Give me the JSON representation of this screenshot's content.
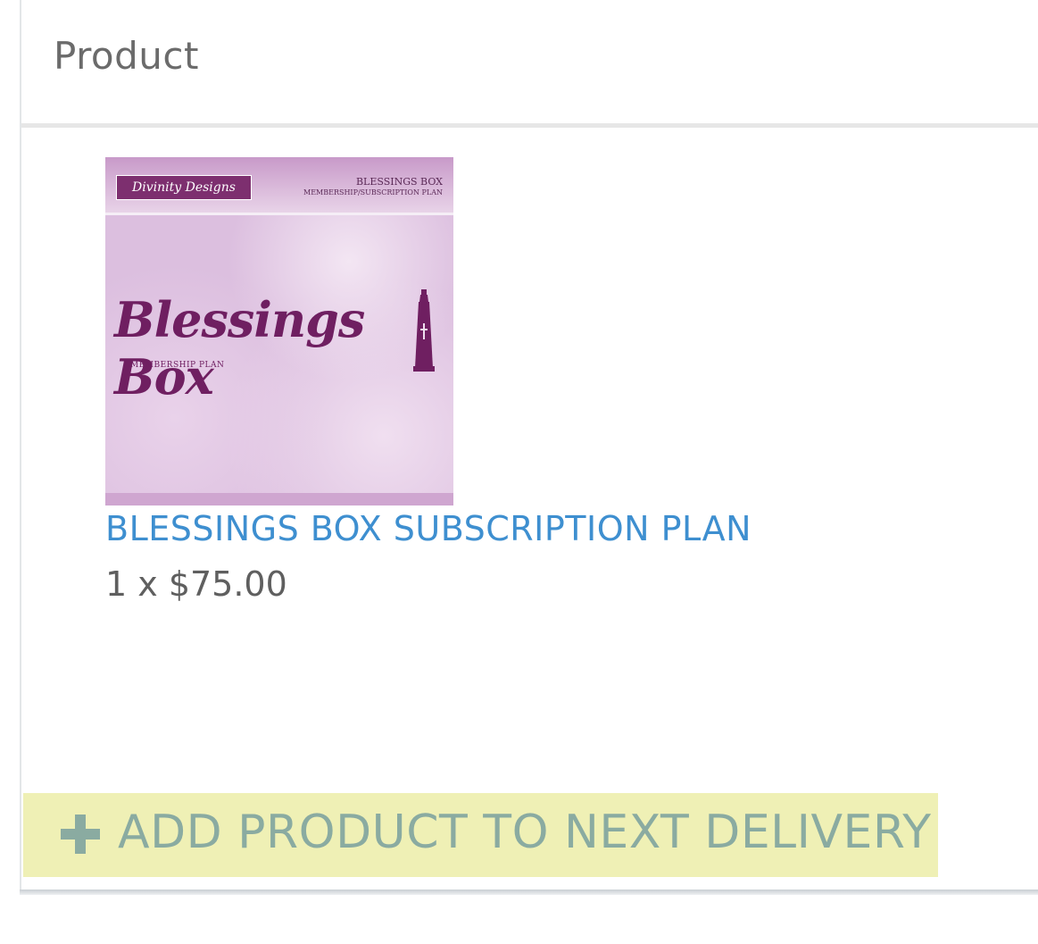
{
  "header": {
    "title": "Product"
  },
  "product": {
    "image": {
      "alt_icon": "product-image",
      "brand": "Divinity Designs",
      "caption_title": "BLESSINGS BOX",
      "caption_sub": "MEMBERSHIP/SUBSCRIPTION PLAN",
      "headline": "Blessings Box",
      "subline": "MEMBERSHIP PLAN"
    },
    "name": "BLESSINGS BOX SUBSCRIPTION PLAN",
    "qty_price": "1 x $75.00"
  },
  "actions": {
    "add_product_label": "ADD PRODUCT TO NEXT DELIVERY",
    "add_icon": "plus-icon"
  },
  "colors": {
    "link": "#3e8fd0",
    "add_button_bg": "#eff0b5",
    "add_button_text": "#8aaba1",
    "brand_purple": "#6f1f61"
  }
}
